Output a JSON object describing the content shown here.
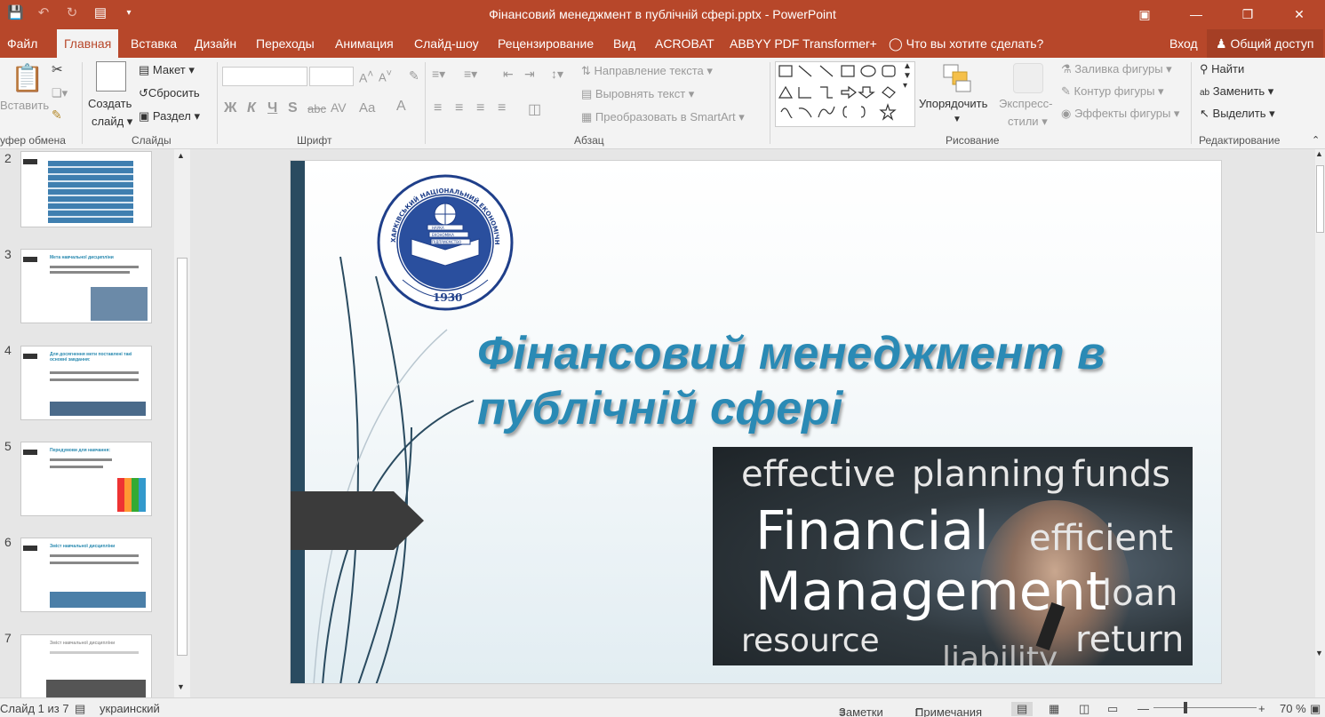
{
  "window": {
    "title": "Фінансовий менеджмент в публічній сфері.pptx - PowerPoint",
    "accent": "#b7472a"
  },
  "quick_access": [
    "save-icon",
    "undo-icon",
    "redo-icon",
    "start-from-beginning-icon",
    "customize-icon"
  ],
  "tabs": [
    "Файл",
    "Главная",
    "Вставка",
    "Дизайн",
    "Переходы",
    "Анимация",
    "Слайд-шоу",
    "Рецензирование",
    "Вид",
    "ACROBAT",
    "ABBYY PDF Transformer+"
  ],
  "tell_me": "Что вы хотите сделать?",
  "signin": "Вход",
  "share": "Общий доступ",
  "ribbon": {
    "clipboard": {
      "paste": "Вставить",
      "group": "уфер обмена"
    },
    "slides": {
      "new_slide_l1": "Создать",
      "new_slide_l2": "слайд",
      "layout": "Макет",
      "reset": "Сбросить",
      "section": "Раздел",
      "group": "Слайды"
    },
    "font": {
      "group": "Шрифт",
      "bold": "Ж",
      "italic": "К",
      "underline": "Ч",
      "strike": "S",
      "abc": "abc",
      "spacing": "AV",
      "case": "Aa",
      "color": "A"
    },
    "paragraph": {
      "text_direction": "Направление текста",
      "align_text": "Выровнять текст",
      "smartart": "Преобразовать в SmartArt",
      "group": "Абзац"
    },
    "drawing": {
      "arrange": "Упорядочить",
      "quick_styles_l1": "Экспресс-",
      "quick_styles_l2": "стили",
      "fill": "Заливка фигуры",
      "outline": "Контур фигуры",
      "effects": "Эффекты фигуры",
      "group": "Рисование"
    },
    "editing": {
      "find": "Найти",
      "replace": "Заменить",
      "select": "Выделить",
      "group": "Редактирование"
    }
  },
  "thumbnails": [
    {
      "num": "2",
      "title": ""
    },
    {
      "num": "3",
      "title": "Мета навчальної дисципліни"
    },
    {
      "num": "4",
      "title": "Для досягнення мети поставлені такі основні завдання:"
    },
    {
      "num": "5",
      "title": "Передумови для навчання:"
    },
    {
      "num": "6",
      "title": "Зміст навчальної дисципліни"
    },
    {
      "num": "7",
      "title": "Зміст навчальної дисципліни"
    }
  ],
  "slide": {
    "title_line1": "Фінансовий менеджмент в",
    "title_line2": "публічній сфері",
    "logo_text": "ХАРКІВСЬКИЙ НАЦІОНАЛЬНИЙ ЕКОНОМІЧНИЙ УНІВЕРСИТЕТ ІМЕНІ СЕМЕНА КУЗНЕЦЯ",
    "logo_book": [
      "НАУКА",
      "ЕКОНОМІКА",
      "ПІДПРИЄМСТВО"
    ],
    "logo_year": "1930",
    "photo_words": {
      "effective": "effective",
      "planning": "planning",
      "funds": "funds",
      "financial": "Financial",
      "efficient": "efficient",
      "management": "Management",
      "loan": "loan",
      "resource": "resource",
      "liability": "liability",
      "return": "return"
    },
    "title_color": "#2a8ab5"
  },
  "status": {
    "slide_of": "Слайд 1 из 7",
    "language": "украинский",
    "notes": "Заметки",
    "comments": "Примечания",
    "zoom": "70 %"
  }
}
